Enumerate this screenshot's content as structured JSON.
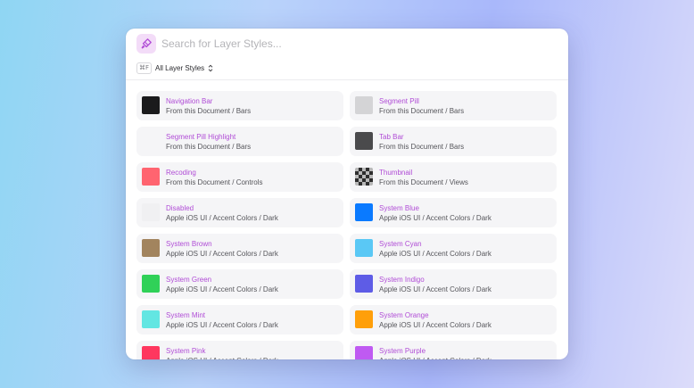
{
  "search": {
    "placeholder": "Search for Layer Styles..."
  },
  "filter": {
    "shortcut": "⌘F",
    "label": "All Layer Styles"
  },
  "styles": [
    {
      "name": "Navigation Bar",
      "path": "From this Document / Bars",
      "color": "#1a1a1c"
    },
    {
      "name": "Segment Pill",
      "path": "From this Document / Bars",
      "color": "#d4d4d6"
    },
    {
      "name": "Segment Pill Highlight",
      "path": "From this Document / Bars",
      "color": "#f5f5f7"
    },
    {
      "name": "Tab Bar",
      "path": "From this Document / Bars",
      "color": "#4a4a4c"
    },
    {
      "name": "Recoding",
      "path": "From this Document / Controls",
      "color": "#ff6470"
    },
    {
      "name": "Thumbnail",
      "path": "From this Document / Views",
      "color": "checker"
    },
    {
      "name": "Disabled",
      "path": "Apple iOS UI / Accent Colors / Dark",
      "color": "#f0f0f2"
    },
    {
      "name": "System Blue",
      "path": "Apple iOS UI / Accent Colors / Dark",
      "color": "#0a7aff"
    },
    {
      "name": "System Brown",
      "path": "Apple iOS UI / Accent Colors / Dark",
      "color": "#a2845e"
    },
    {
      "name": "System Cyan",
      "path": "Apple iOS UI / Accent Colors / Dark",
      "color": "#5ac8f5"
    },
    {
      "name": "System Green",
      "path": "Apple iOS UI / Accent Colors / Dark",
      "color": "#30d158"
    },
    {
      "name": "System Indigo",
      "path": "Apple iOS UI / Accent Colors / Dark",
      "color": "#5e5ce6"
    },
    {
      "name": "System Mint",
      "path": "Apple iOS UI / Accent Colors / Dark",
      "color": "#63e6e2"
    },
    {
      "name": "System Orange",
      "path": "Apple iOS UI / Accent Colors / Dark",
      "color": "#ff9f0a"
    },
    {
      "name": "System Pink",
      "path": "Apple iOS UI / Accent Colors / Dark",
      "color": "#ff375f"
    },
    {
      "name": "System Purple",
      "path": "Apple iOS UI / Accent Colors / Dark",
      "color": "#bf5af2"
    }
  ]
}
